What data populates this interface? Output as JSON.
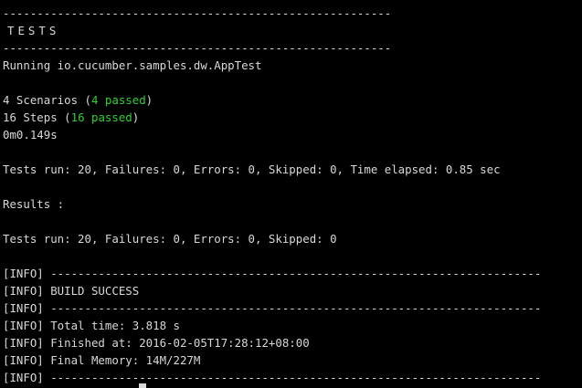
{
  "terminal": {
    "divider_top": "---------------------------------------------------------",
    "tests_title": "TESTS",
    "divider_sub": "---------------------------------------------------------",
    "running": "Running io.cucumber.samples.dw.AppTest",
    "scenarios": {
      "prefix": "4 Scenarios (",
      "passed": "4 passed",
      "suffix": ")"
    },
    "steps": {
      "prefix": "16 Steps (",
      "passed": "16 passed",
      "suffix": ")"
    },
    "duration": "0m0.149s",
    "tests_run_1": "Tests run: 20, Failures: 0, Errors: 0, Skipped: 0, Time elapsed: 0.85 sec",
    "results_label": "Results :",
    "tests_run_2": "Tests run: 20, Failures: 0, Errors: 0, Skipped: 0",
    "info_divider_1": "[INFO] ------------------------------------------------------------------------",
    "build_success": "[INFO] BUILD SUCCESS",
    "info_divider_2": "[INFO] ------------------------------------------------------------------------",
    "total_time": "[INFO] Total time: 3.818 s",
    "finished_at": "[INFO] Finished at: 2016-02-05T17:28:12+08:00",
    "final_memory": "[INFO] Final Memory: 14M/227M",
    "info_divider_3": "[INFO] ------------------------------------------------------------------------"
  },
  "colors": {
    "background": "#000000",
    "text": "#d8d8d8",
    "passed": "#2fd12f"
  }
}
